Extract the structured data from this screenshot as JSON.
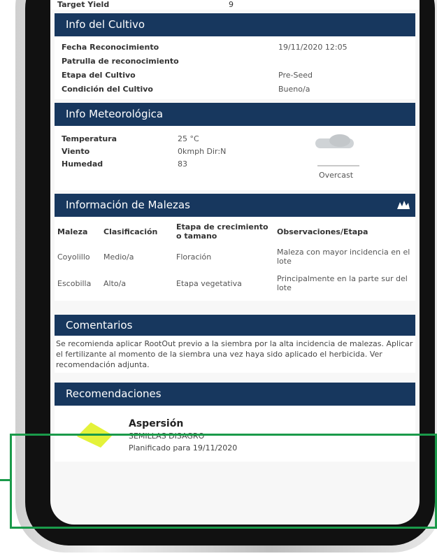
{
  "target": {
    "label": "Target Yield",
    "value": "9"
  },
  "cultivo": {
    "header": "Info del Cultivo",
    "rows": [
      {
        "label": "Fecha Reconocimiento",
        "value": "19/11/2020 12:05"
      },
      {
        "label": "Patrulla de reconocimiento",
        "value": ""
      },
      {
        "label": "Etapa del Cultivo",
        "value": "Pre-Seed"
      },
      {
        "label": "Condición del Cultivo",
        "value": "Bueno/a"
      }
    ]
  },
  "meteo": {
    "header": "Info Meteorológica",
    "rows": [
      {
        "label": "Temperatura",
        "value": "25 °C"
      },
      {
        "label": "Viento",
        "value": "0kmph Dir:N"
      },
      {
        "label": "Humedad",
        "value": "83"
      }
    ],
    "condition": "Overcast",
    "icon": "cloud-icon"
  },
  "malezas": {
    "header": "Información de Malezas",
    "icon": "weed-icon",
    "columns": [
      "Maleza",
      "Clasificación",
      "Etapa de crecimiento o tamano",
      "Observaciones/Etapa"
    ],
    "rows": [
      [
        "Coyolillo",
        "Medio/a",
        "Floración",
        "Maleza con mayor incidencia en el lote"
      ],
      [
        "Escobilla",
        "Alto/a",
        "Etapa vegetativa",
        "Principalmente en la parte sur del lote"
      ]
    ]
  },
  "comentarios": {
    "header": "Comentarios",
    "text": "Se recomienda aplicar RootOut previo a la siembra por la alta incidencia de malezas. Aplicar el fertilizante al momento de la siembra una vez haya sido aplicado el herbicida. Ver recomendación adjunta."
  },
  "recomendaciones": {
    "header": "Recomendaciones",
    "item": {
      "title": "Aspersión",
      "subtitle": "SEMILLAS DISAGRO",
      "date": "Planificado para 19/11/2020"
    }
  },
  "colors": {
    "header_bg": "#17375e",
    "highlight": "#1a9a4a",
    "rec_shape": "#e4f23a"
  }
}
